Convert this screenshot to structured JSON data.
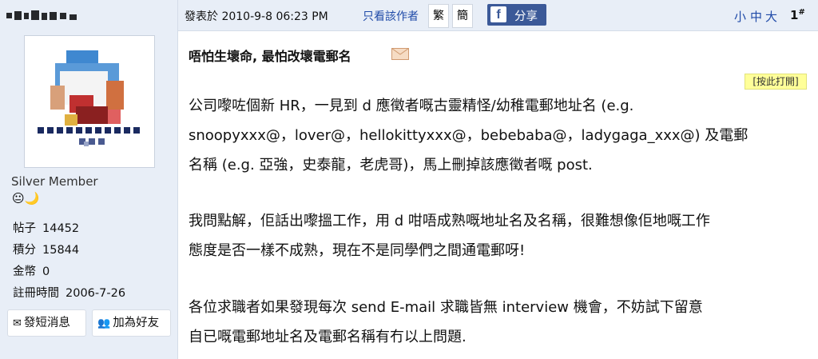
{
  "post": {
    "posted_label": "發表於 2010-9-8 06:23 PM",
    "only_author": "只看該作者",
    "trad_label": "繁",
    "simp_label": "簡",
    "share_label": "分享",
    "font_small": "小",
    "font_medium": "中",
    "font_large": "大",
    "floor_number": "1",
    "floor_mark": "#",
    "title": "唔怕生壞命, 最怕改壞電郵名",
    "print_label": "[按此打開]",
    "paragraphs": [
      [
        "公司嚟咗個新 HR，一見到 d 應徵者嘅古靈精怪/幼稚電郵地址名 (e.g.",
        "snoopyxxx@，lover@，hellokittyxxx@，bebebaba@，ladygaga_xxx@) 及電郵",
        "名稱 (e.g. 亞強，史泰龍，老虎哥)，馬上刪掉該應徵者嘅 post."
      ],
      [
        "我問點解，佢話出嚟搵工作，用 d 咁唔成熟嘅地址名及名稱，很難想像佢地嘅工作",
        "態度是否一樣不成熟，現在不是同學們之間通電郵呀!"
      ],
      [
        "各位求職者如果發現每次 send E-mail 求職皆無 interview 機會，不妨試下留意",
        "自已嘅電郵地址名及電郵名稱有冇以上問題."
      ]
    ]
  },
  "user": {
    "rank": "Silver Member",
    "rank_icons": "😐🌙",
    "stats": [
      {
        "label": "帖子",
        "value": "14452"
      },
      {
        "label": "積分",
        "value": "15844"
      },
      {
        "label": "金幣",
        "value": "0"
      },
      {
        "label": "註冊時間",
        "value": "2006-7-26"
      }
    ],
    "pm_label": "發短消息",
    "friend_label": "加為好友"
  },
  "colors": {
    "panel_bg": "#E8EEF7",
    "link": "#1f4aa8",
    "facebook": "#3b5998",
    "print_bg": "#ffff99"
  }
}
